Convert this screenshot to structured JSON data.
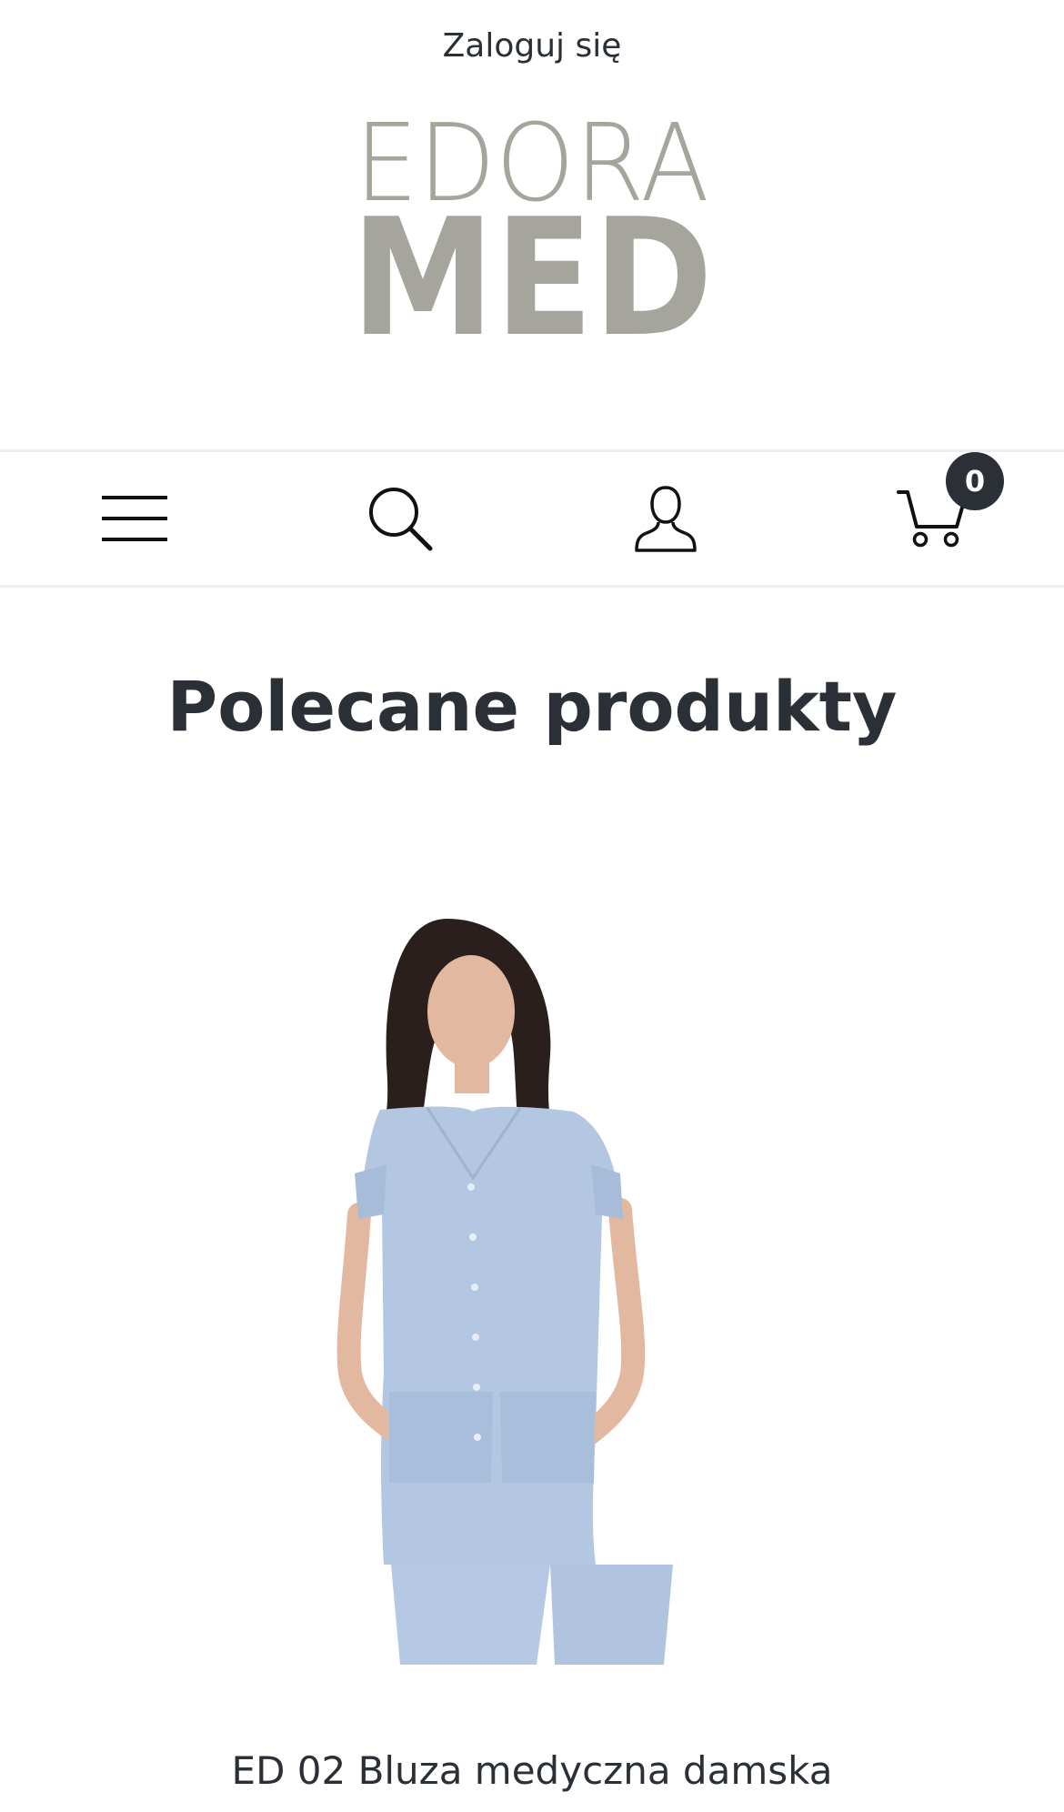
{
  "header": {
    "login_label": "Zaloguj się",
    "logo": {
      "line1": "EDORA",
      "line2": "MED",
      "color": "#a5a59d"
    }
  },
  "nav": {
    "icons": [
      "menu-icon",
      "search-icon",
      "account-icon",
      "cart-icon"
    ],
    "cart_count": "0"
  },
  "featured": {
    "title": "Polecane produkty",
    "product": {
      "name": "ED 02 Bluza medyczna damska",
      "image_colors": {
        "scrubs": "#b3c7e3",
        "hair": "#2a1f1c",
        "skin": "#e3b8a0"
      }
    }
  }
}
